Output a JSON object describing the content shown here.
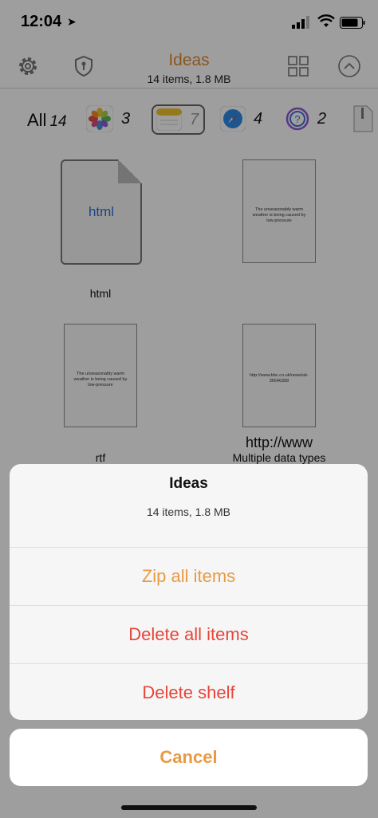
{
  "status": {
    "time": "12:04"
  },
  "nav": {
    "title": "Ideas",
    "subtitle": "14 items, 1.8 MB"
  },
  "filters": {
    "all_label": "All",
    "all_count": "14",
    "photos_count": "3",
    "notes_count": "7",
    "safari_count": "4",
    "other_count": "2"
  },
  "items": [
    {
      "label": "html",
      "thumb_text": "html"
    },
    {
      "label": "",
      "thumb_text": "The unseasonably warm weather is being caused by low-pressure"
    },
    {
      "label": "rtf",
      "thumb_text": "The unseasonably warm weather is being caused by low-pressure"
    },
    {
      "label_line1": "http://www",
      "label_line2": "Multiple data types",
      "thumb_text": "http://www.bbc.co.uk/news/uk-36646358"
    }
  ],
  "sheet": {
    "title": "Ideas",
    "subtitle": "14 items, 1.8 MB",
    "actions": [
      {
        "label": "Zip all items",
        "color": "#e89a43"
      },
      {
        "label": "Delete all items",
        "color": "#e5453a"
      },
      {
        "label": "Delete shelf",
        "color": "#e5453a"
      }
    ],
    "cancel": "Cancel"
  },
  "colors": {
    "accent": "#e38b31",
    "destructive": "#e5453a",
    "background": "#ffffff"
  },
  "icons": [
    "gear-icon",
    "shield-key-icon",
    "grid-view-icon",
    "chevron-up-circle-icon",
    "photos-icon",
    "notes-icon",
    "safari-icon",
    "question-icon",
    "zip-file-icon"
  ]
}
